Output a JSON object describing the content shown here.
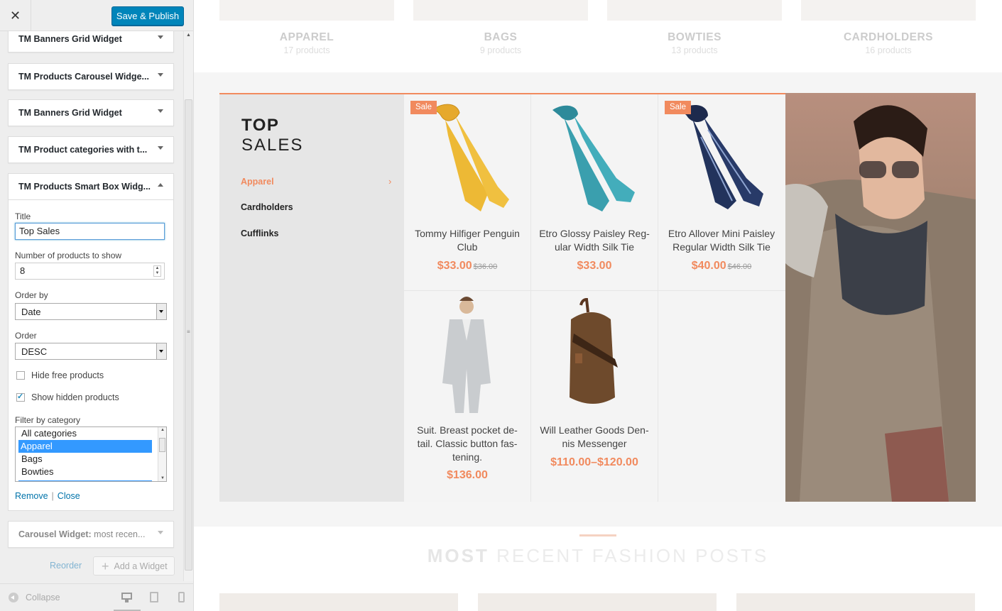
{
  "sidebar": {
    "close_icon": "close-icon",
    "publish_label": "Save & Publish",
    "widgets_above": [
      {
        "title": "TM Banners Grid Widget"
      },
      {
        "title": "TM Products Carousel Widge..."
      },
      {
        "title": "TM Banners Grid Widget"
      },
      {
        "title": "TM Product categories with t..."
      }
    ],
    "open_widget": {
      "title": "TM Products Smart Box Widg...",
      "fields": {
        "title_label": "Title",
        "title_value": "Top Sales",
        "number_label": "Number of products to show",
        "number_value": "8",
        "orderby_label": "Order by",
        "orderby_value": "Date",
        "order_label": "Order",
        "order_value": "DESC",
        "hide_free_label": "Hide free products",
        "hide_free_checked": false,
        "show_hidden_label": "Show hidden products",
        "show_hidden_checked": true,
        "filter_label": "Filter by category",
        "filter_options": [
          "All categories",
          "Apparel",
          "Bags",
          "Bowties"
        ],
        "filter_selected": "Apparel"
      },
      "remove_label": "Remove",
      "separator": "|",
      "close_label": "Close"
    },
    "dim_widget": {
      "title_bold": "Carousel Widget:",
      "title_rest": "most recen..."
    },
    "reorder_label": "Reorder",
    "add_widget_label": "Add a Widget",
    "collapse_label": "Collapse"
  },
  "preview": {
    "categories": [
      {
        "name": "APPAREL",
        "count": "17 products"
      },
      {
        "name": "BAGS",
        "count": "9 products"
      },
      {
        "name": "BOWTIES",
        "count": "13 products"
      },
      {
        "name": "CARDHOLDERS",
        "count": "16 products"
      }
    ],
    "smart_box": {
      "title_line1": "TOP",
      "title_line2": "SALES",
      "categories": [
        "Apparel",
        "Cardholders",
        "Cufflinks"
      ],
      "active_category": "Apparel",
      "products": [
        {
          "name": "Tommy Hilfiger Penguin Club",
          "price": "$33.00",
          "old_price": "$36.00",
          "sale": "Sale"
        },
        {
          "name": "Etro Glossy Paisley Reg-ular Width Silk Tie",
          "price": "$33.00",
          "old_price": "",
          "sale": ""
        },
        {
          "name": "Etro Allover Mini Paisley Regular Width Silk Tie",
          "price": "$40.00",
          "old_price": "$46.00",
          "sale": "Sale"
        },
        {
          "name": "Suit. Breast pocket de-tail. Classic button fas-tening.",
          "price": "$136.00",
          "old_price": "",
          "sale": ""
        },
        {
          "name": "Will Leather Goods Den-nis Messenger",
          "price": "$110.00–$120.00",
          "old_price": "",
          "sale": ""
        }
      ]
    },
    "posts_title_bold": "MOST",
    "posts_title_rest": "RECENT FASHION POSTS"
  },
  "colors": {
    "accent": "#f18a5e",
    "primary_button": "#0085ba",
    "link": "#0073aa"
  }
}
